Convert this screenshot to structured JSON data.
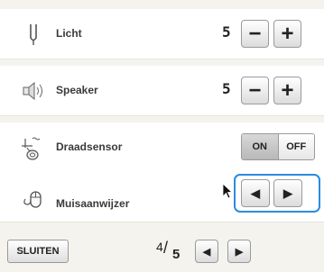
{
  "settings": {
    "light": {
      "label": "Licht",
      "value": "5",
      "icon": "needle-light-icon"
    },
    "speaker": {
      "label": "Speaker",
      "value": "5",
      "icon": "speaker-icon"
    },
    "thread_sensor": {
      "label": "Draadsensor",
      "on_label": "ON",
      "off_label": "OFF",
      "state": "ON",
      "icon": "thread-sensor-icon"
    },
    "mouse_pointer": {
      "label": "Muisaanwijzer",
      "icon": "mouse-icon"
    }
  },
  "controls": {
    "minus": "−",
    "plus": "+",
    "left_arrow": "◀",
    "right_arrow": "▶"
  },
  "footer": {
    "close_label": "SLUITEN",
    "page_current": "4",
    "page_total": "5",
    "page_slash": "/"
  },
  "colors": {
    "focus": "#2a8be0",
    "row_background": "#ffffff",
    "panel_background": "#f4f3ee"
  }
}
